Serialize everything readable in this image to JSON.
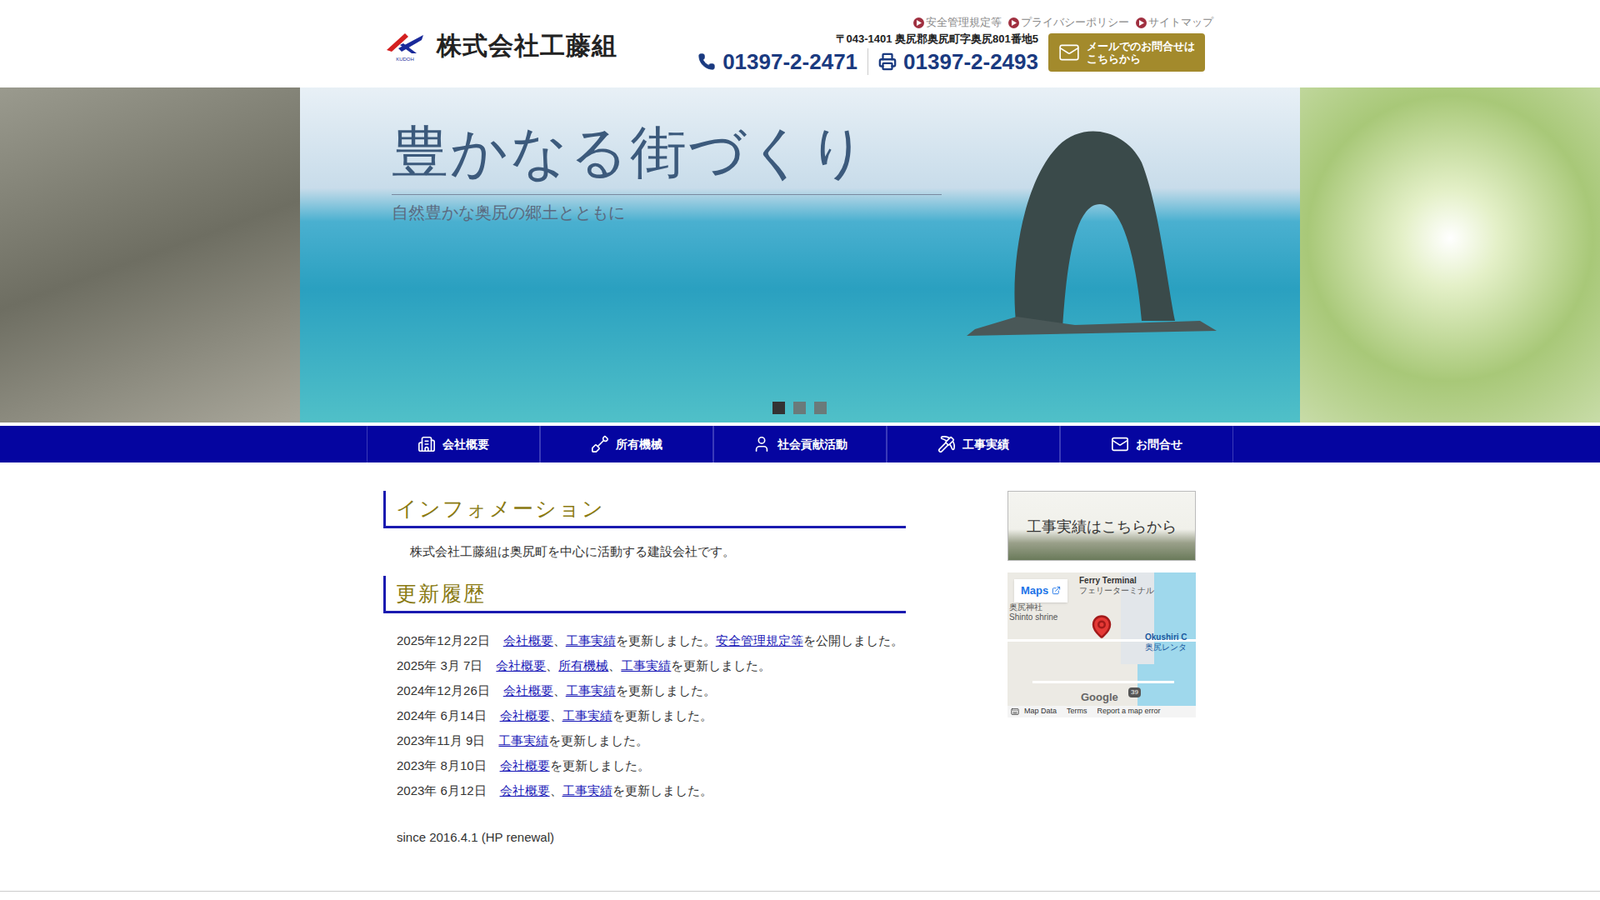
{
  "header": {
    "logo_mark": "KUDOH",
    "company": "株式会社工藤組",
    "top_links": [
      "安全管理規定等",
      "プライバシーポリシー",
      "サイトマップ"
    ],
    "address": "〒043-1401 奥尻郡奥尻町字奥尻801番地5",
    "tel": "01397-2-2471",
    "fax": "01397-2-2493",
    "mail_button": [
      "メールでのお問合せは",
      "こちらから"
    ]
  },
  "hero": {
    "title": "豊かなる街づくり",
    "subtitle": "自然豊かな奥尻の郷土とともに",
    "dots": [
      {
        "selected": true
      },
      {
        "selected": false
      },
      {
        "selected": false
      }
    ]
  },
  "nav": [
    {
      "label": "会社概要",
      "icon": "building"
    },
    {
      "label": "所有機械",
      "icon": "machine"
    },
    {
      "label": "社会貢献活動",
      "icon": "person"
    },
    {
      "label": "工事実績",
      "icon": "pickaxe"
    },
    {
      "label": "お問合せ",
      "icon": "mail"
    }
  ],
  "info": {
    "heading": "インフォメーション",
    "text": "株式会社工藤組は奥尻町を中心に活動する建設会社です。"
  },
  "updates": {
    "heading": "更新履歴",
    "rows": [
      {
        "date": "2025年12月22日",
        "parts": [
          {
            "text": "会社概要",
            "link": true
          },
          {
            "text": "、",
            "link": false
          },
          {
            "text": "工事実績",
            "link": true
          },
          {
            "text": "を更新しました。",
            "link": false
          },
          {
            "text": "安全管理規定等",
            "link": true
          },
          {
            "text": "を公開しました。",
            "link": false
          }
        ]
      },
      {
        "date": "2025年 3月 7日",
        "parts": [
          {
            "text": "会社概要",
            "link": true
          },
          {
            "text": "、",
            "link": false
          },
          {
            "text": "所有機械",
            "link": true
          },
          {
            "text": "、",
            "link": false
          },
          {
            "text": "工事実績",
            "link": true
          },
          {
            "text": "を更新しました。",
            "link": false
          }
        ]
      },
      {
        "date": "2024年12月26日",
        "parts": [
          {
            "text": "会社概要",
            "link": true
          },
          {
            "text": "、",
            "link": false
          },
          {
            "text": "工事実績",
            "link": true
          },
          {
            "text": "を更新しました。",
            "link": false
          }
        ]
      },
      {
        "date": "2024年 6月14日",
        "parts": [
          {
            "text": "会社概要",
            "link": true
          },
          {
            "text": "、",
            "link": false
          },
          {
            "text": "工事実績",
            "link": true
          },
          {
            "text": "を更新しました。",
            "link": false
          }
        ]
      },
      {
        "date": "2023年11月 9日",
        "parts": [
          {
            "text": "工事実績",
            "link": true
          },
          {
            "text": "を更新しました。",
            "link": false
          }
        ]
      },
      {
        "date": "2023年 8月10日",
        "parts": [
          {
            "text": "会社概要",
            "link": true
          },
          {
            "text": "を更新しました。",
            "link": false
          }
        ]
      },
      {
        "date": "2023年 6月12日",
        "parts": [
          {
            "text": "会社概要",
            "link": true
          },
          {
            "text": "、",
            "link": false
          },
          {
            "text": "工事実績",
            "link": true
          },
          {
            "text": "を更新しました。",
            "link": false
          }
        ]
      }
    ],
    "since": "since 2016.4.1 (HP renewal)"
  },
  "sidebar": {
    "banner": "工事実績はこちらから",
    "map": {
      "button": "Maps",
      "labels": [
        "Ferry Terminal",
        "フェリーターミナル",
        "奥尻神社",
        "Shinto shrine",
        "Okushiri C",
        "奥尻レンタ"
      ],
      "road": "39",
      "brand": "Google",
      "footer": [
        "Map Data",
        "Terms",
        "Report a map error"
      ]
    }
  }
}
